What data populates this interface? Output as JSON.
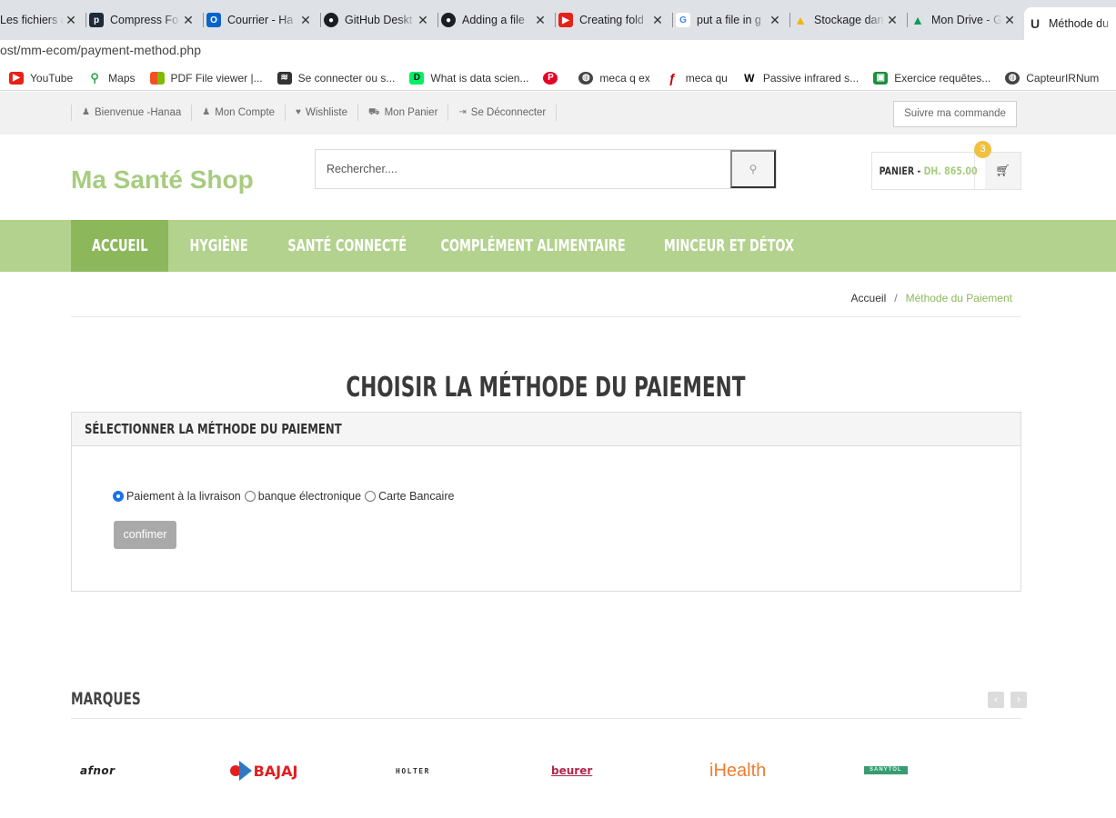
{
  "browser": {
    "tabs": [
      {
        "title": "Les fichiers d",
        "icon": "folder-icon",
        "color": "#888888"
      },
      {
        "title": "Compress Fo",
        "icon": "pdf-icon",
        "color": "#1e2a3a"
      },
      {
        "title": "Courrier - Ha",
        "icon": "outlook-icon",
        "color": "#0a64c8"
      },
      {
        "title": "GitHub Deskt",
        "icon": "github-icon",
        "color": "#1b1f23"
      },
      {
        "title": "Adding a file",
        "icon": "github-icon",
        "color": "#1b1f23"
      },
      {
        "title": "Creating fold",
        "icon": "youtube-icon",
        "color": "#e62117"
      },
      {
        "title": "put a file in g",
        "icon": "google-icon",
        "color": "#4285f4"
      },
      {
        "title": "Stockage dan",
        "icon": "drive-icon",
        "color": "#f4b400"
      },
      {
        "title": "Mon Drive - G",
        "icon": "drive-icon",
        "color": "#0f9d58"
      },
      {
        "title": "Méthode du",
        "icon": "site-icon",
        "color": "#333333"
      }
    ],
    "url": "ost/mm-ecom/payment-method.php",
    "bookmarks": [
      {
        "label": "YouTube",
        "icon": "youtube-icon",
        "color": "#e62117"
      },
      {
        "label": "Maps",
        "icon": "maps-pin-icon",
        "color": "#34a853"
      },
      {
        "label": "PDF File viewer |...",
        "icon": "microsoft-icon",
        "color": "#f25022"
      },
      {
        "label": "Se connecter ou s...",
        "icon": "site-icon",
        "color": "#333333"
      },
      {
        "label": "What is data scien...",
        "icon": "datacamp-icon",
        "color": "#03ef62"
      },
      {
        "label": "",
        "icon": "pinterest-icon",
        "color": "#e60023"
      },
      {
        "label": "meca q ex",
        "icon": "globe-icon",
        "color": "#444444"
      },
      {
        "label": "meca qu",
        "icon": "function-icon",
        "color": "#c00000"
      },
      {
        "label": "Passive infrared s...",
        "icon": "wikipedia-icon",
        "color": "#000000"
      },
      {
        "label": "Exercice requêtes...",
        "icon": "classroom-icon",
        "color": "#1e8e3e"
      },
      {
        "label": "CapteurIRNum",
        "icon": "globe-icon",
        "color": "#444444"
      }
    ]
  },
  "topbar": {
    "links": [
      {
        "label": "Bienvenue -Hanaa",
        "icon": "user-icon"
      },
      {
        "label": "Mon Compte",
        "icon": "user-icon"
      },
      {
        "label": "Wishliste",
        "icon": "heart-icon"
      },
      {
        "label": "Mon Panier",
        "icon": "cart-icon"
      },
      {
        "label": "Se Déconnecter",
        "icon": "logout-icon"
      }
    ],
    "track_order": "Suivre ma commande"
  },
  "header": {
    "logo": "Ma Santé Shop",
    "search_placeholder": "Rechercher....",
    "cart_label": "PANIER -",
    "cart_amount": "DH. 865.00",
    "cart_count": "3",
    "accent_color": "#a7cc7f",
    "badge_color": "#f0c040"
  },
  "nav": {
    "items": [
      {
        "label": "ACCUEIL",
        "active": true
      },
      {
        "label": "HYGIÈNE",
        "active": false
      },
      {
        "label": "SANTÉ CONNECTÉ",
        "active": false
      },
      {
        "label": "COMPLÉMENT ALIMENTAIRE",
        "active": false
      },
      {
        "label": "MINCEUR ET DÉTOX",
        "active": false
      }
    ],
    "bar_color": "#b2d28d",
    "active_color": "#8cb85b"
  },
  "breadcrumb": {
    "home": "Accueil",
    "separator": "/",
    "current": "Méthode du Paiement"
  },
  "main": {
    "title": "CHOISIR LA MÉTHODE DU PAIEMENT",
    "panel_title": "SÉLECTIONNER LA MÉTHODE DU PAIEMENT",
    "payment_options": [
      {
        "label": "Paiement à la livraison",
        "checked": true
      },
      {
        "label": "banque électronique",
        "checked": false
      },
      {
        "label": "Carte Bancaire",
        "checked": false
      }
    ],
    "confirm_label": "confimer"
  },
  "brands": {
    "title": "MARQUES",
    "prev": "‹",
    "next": "›",
    "logos": [
      "afnor",
      "BAJAJ",
      "HOLTER",
      "beurer",
      "iHealth",
      "SANYTOL"
    ]
  }
}
